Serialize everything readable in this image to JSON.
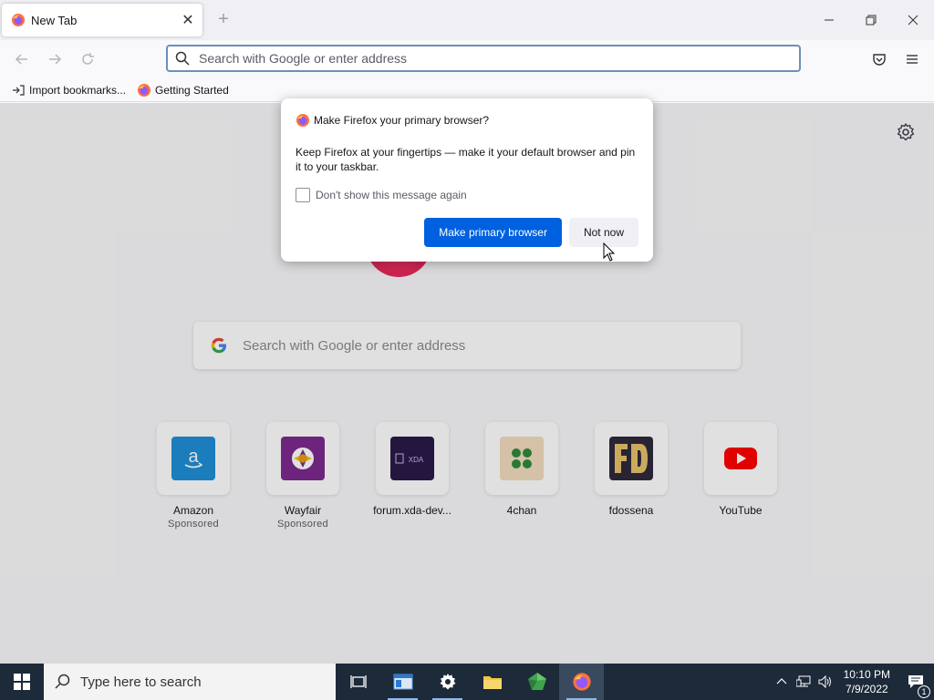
{
  "tab": {
    "title": "New Tab",
    "close": "✕",
    "new": "+"
  },
  "window": {
    "minimize": "—",
    "maximize": "❐",
    "close": "✕"
  },
  "navbar": {
    "url_placeholder": "Search with Google or enter address"
  },
  "bookmarks": [
    {
      "label": "Import bookmarks...",
      "icon": "import-icon"
    },
    {
      "label": "Getting Started",
      "icon": "firefox-icon"
    }
  ],
  "search": {
    "placeholder": "Search with Google or enter address"
  },
  "tiles": [
    {
      "label": "Amazon",
      "sub": "Sponsored",
      "icon": "amazon-icon",
      "color": "#1f8fd6"
    },
    {
      "label": "Wayfair",
      "sub": "Sponsored",
      "icon": "wayfair-icon",
      "color": "#7b2a8e"
    },
    {
      "label": "forum.xda-dev...",
      "sub": "",
      "icon": "xda-icon",
      "color": "#2a1a48"
    },
    {
      "label": "4chan",
      "sub": "",
      "icon": "4chan-icon",
      "color": "#f3dcc0"
    },
    {
      "label": "fdossena",
      "sub": "",
      "icon": "fdossena-icon",
      "color": "#2e2a3c"
    },
    {
      "label": "YouTube",
      "sub": "",
      "icon": "youtube-icon",
      "color": "#ff0000"
    }
  ],
  "dialog": {
    "title": "Make Firefox your primary browser?",
    "body": "Keep Firefox at your fingertips — make it your default browser and pin it to your taskbar.",
    "checkbox_label": "Don't show this message again",
    "primary_button": "Make primary browser",
    "secondary_button": "Not now"
  },
  "taskbar": {
    "search_placeholder": "Type here to search",
    "time": "10:10 PM",
    "date": "7/9/2022",
    "notification_count": "1"
  }
}
